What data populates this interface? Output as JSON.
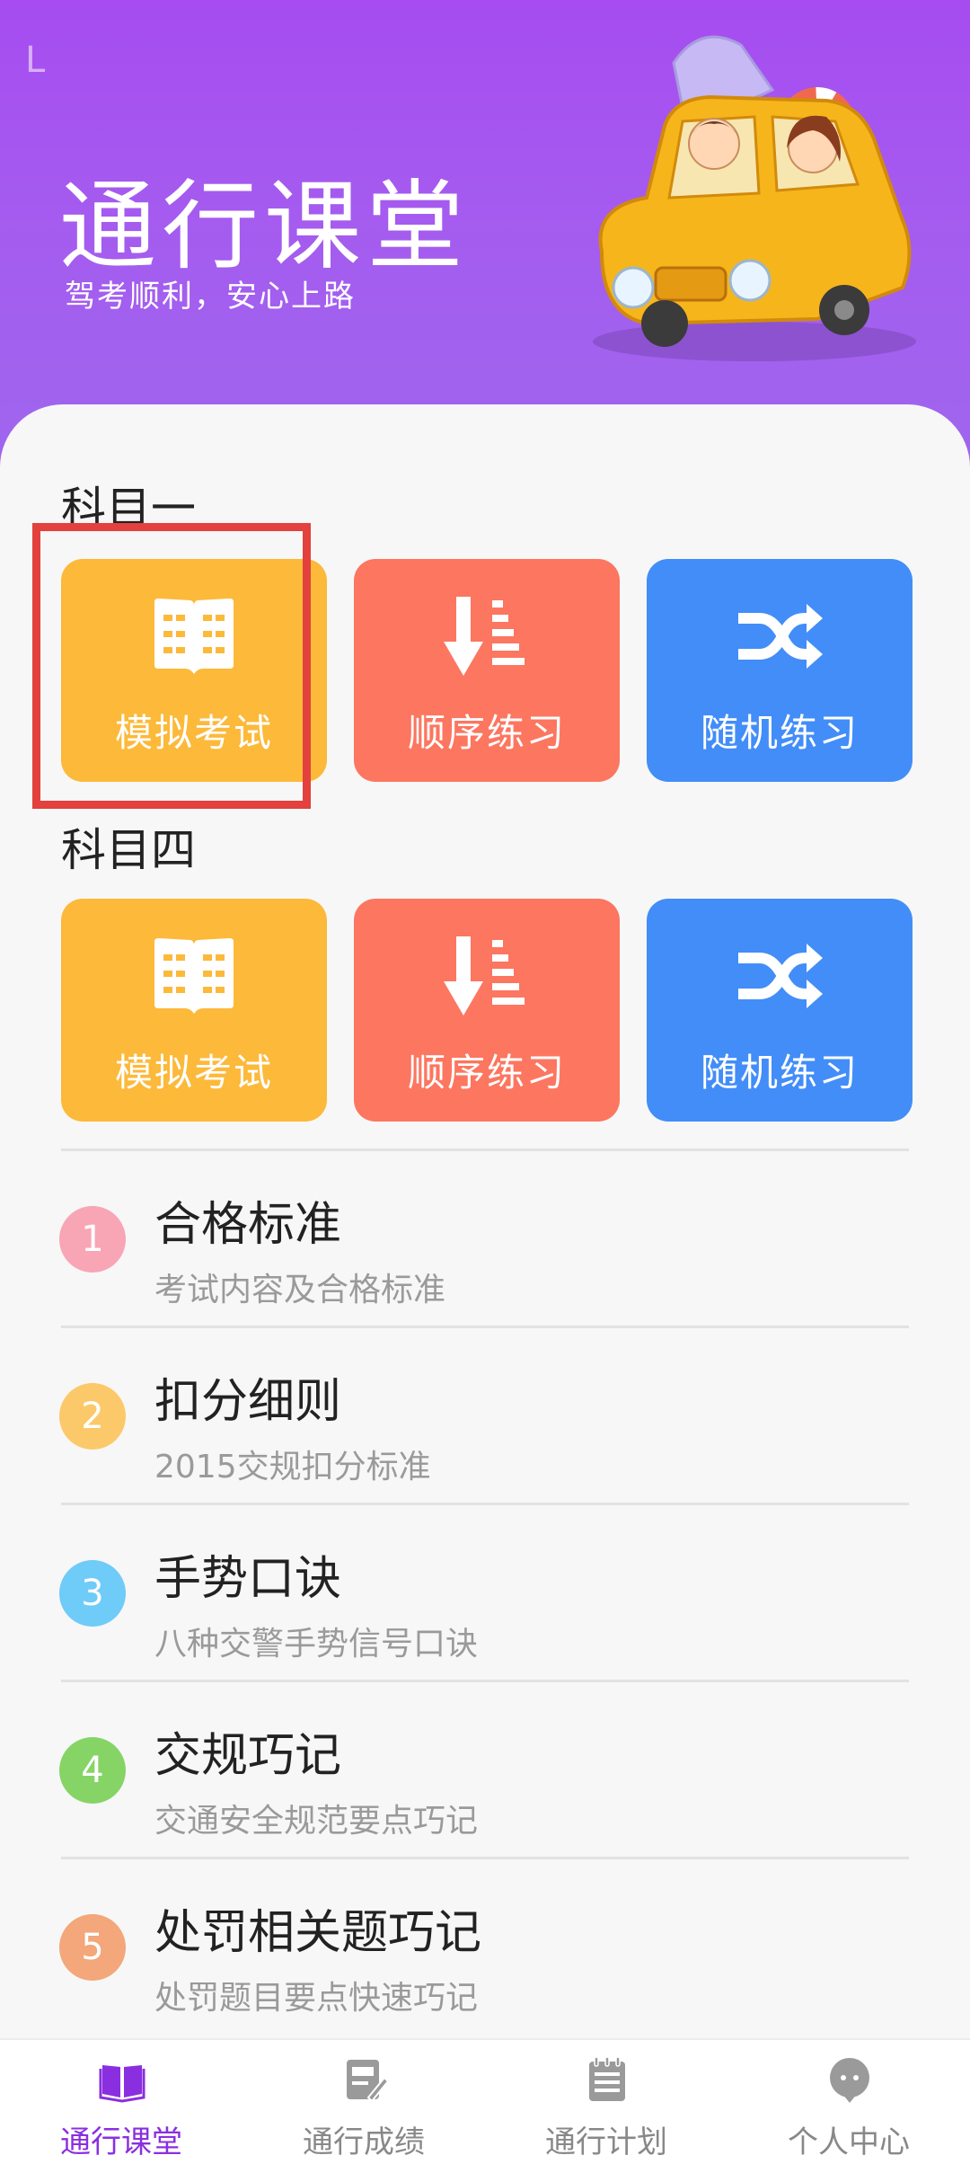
{
  "status": {
    "left_glyph": "L"
  },
  "header": {
    "title": "通行课堂",
    "subtitle": "驾考顺利，安心上路"
  },
  "subject1": {
    "title": "科目一",
    "tiles": [
      {
        "label": "模拟考试",
        "icon": "book-icon",
        "color": "#fcb93a"
      },
      {
        "label": "顺序练习",
        "icon": "sort-down-icon",
        "color": "#fc7660"
      },
      {
        "label": "随机练习",
        "icon": "shuffle-icon",
        "color": "#428df8"
      }
    ]
  },
  "subject4": {
    "title": "科目四",
    "tiles": [
      {
        "label": "模拟考试",
        "icon": "book-icon",
        "color": "#fcb93a"
      },
      {
        "label": "顺序练习",
        "icon": "sort-down-icon",
        "color": "#fc7660"
      },
      {
        "label": "随机练习",
        "icon": "shuffle-icon",
        "color": "#428df8"
      }
    ]
  },
  "list": [
    {
      "num": "1",
      "title": "合格标准",
      "subtitle": "考试内容及合格标准",
      "color": "#f8a5b5"
    },
    {
      "num": "2",
      "title": "扣分细则",
      "subtitle": "2015交规扣分标准",
      "color": "#fcc96a"
    },
    {
      "num": "3",
      "title": "手势口诀",
      "subtitle": "八种交警手势信号口诀",
      "color": "#6fcbf7"
    },
    {
      "num": "4",
      "title": "交规巧记",
      "subtitle": "交通安全规范要点巧记",
      "color": "#86d466"
    },
    {
      "num": "5",
      "title": "处罚相关题巧记",
      "subtitle": "处罚题目要点快速巧记",
      "color": "#f3a77a"
    }
  ],
  "nav": [
    {
      "label": "通行课堂",
      "icon": "book-open-icon",
      "active": true
    },
    {
      "label": "通行成绩",
      "icon": "score-icon",
      "active": false
    },
    {
      "label": "通行计划",
      "icon": "notepad-icon",
      "active": false
    },
    {
      "label": "个人中心",
      "icon": "chat-person-icon",
      "active": false
    }
  ],
  "colors": {
    "accent": "#8a2fe0",
    "header_top": "#a64cf0",
    "header_bottom": "#9f66ee",
    "highlight": "#e3413d"
  }
}
